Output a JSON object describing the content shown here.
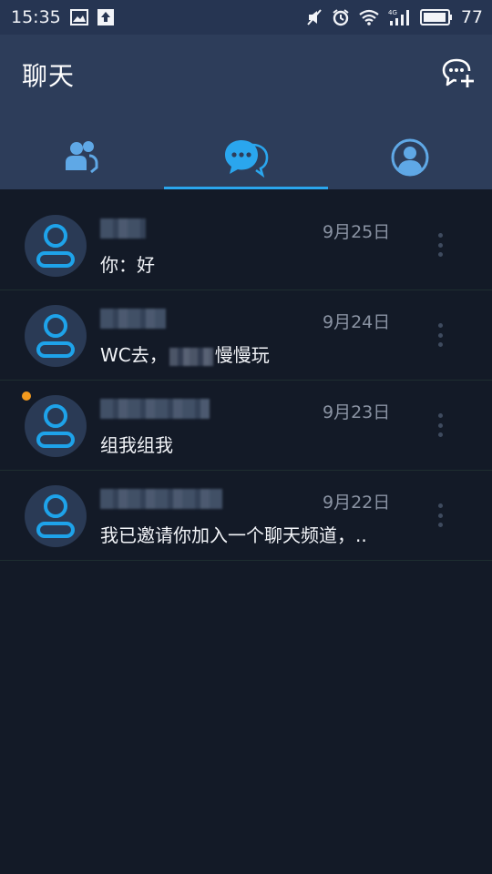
{
  "status_bar": {
    "time": "15:35",
    "battery_level": "77",
    "left_icons": [
      "image-icon",
      "upload-icon"
    ],
    "right_icons": [
      "mute-icon",
      "alarm-icon",
      "wifi-icon",
      "signal-4g-icon",
      "battery-icon"
    ]
  },
  "header": {
    "title": "聊天",
    "new_chat_icon": "chat-add-icon"
  },
  "tabs": [
    {
      "icon": "contacts-icon",
      "active": false
    },
    {
      "icon": "chat-bubbles-icon",
      "active": true
    },
    {
      "icon": "profile-icon",
      "active": false
    }
  ],
  "chats": [
    {
      "date": "9月25日",
      "preview": "你：好",
      "unread": false
    },
    {
      "date": "9月24日",
      "preview_prefix": "WC去，",
      "preview_suffix": "慢慢玩",
      "unread": false
    },
    {
      "date": "9月23日",
      "preview": "组我组我",
      "unread": true
    },
    {
      "date": "9月22日",
      "preview": "我已邀请你加入一个聊天频道，..",
      "unread": false
    }
  ],
  "colors": {
    "accent": "#2aa6ee",
    "header_bg": "#2d3d5a",
    "status_bg": "#263552",
    "list_bg": "#131a27",
    "unread_dot": "#f39a1e",
    "date_text": "#8a93a3"
  }
}
